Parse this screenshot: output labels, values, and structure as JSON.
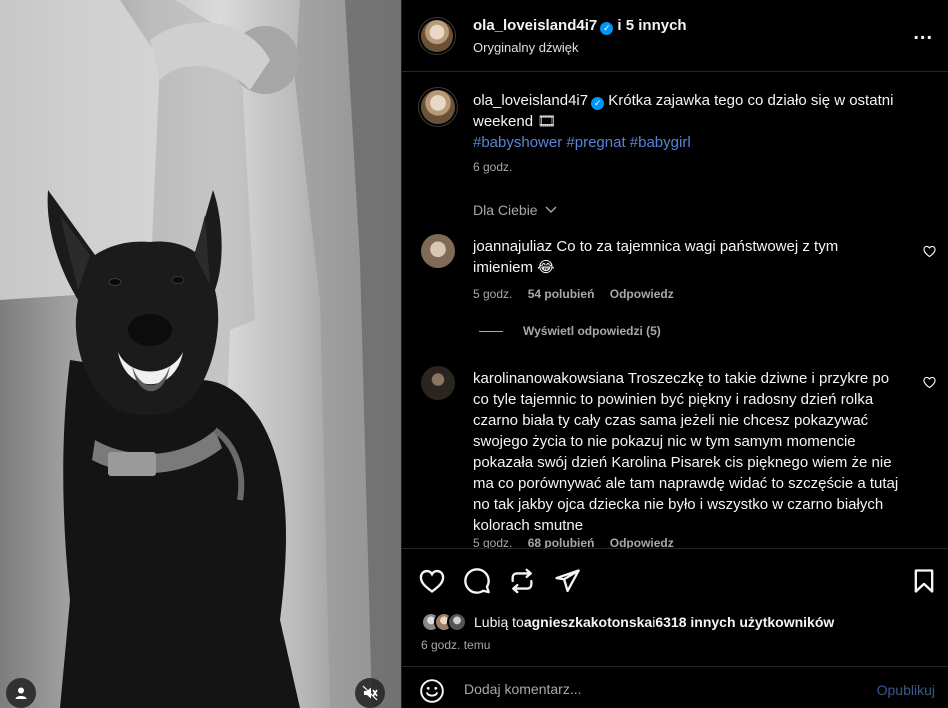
{
  "media": {
    "user_icon": "user-icon",
    "mute_icon": "speaker-muted-icon"
  },
  "header": {
    "username": "ola_loveisland4i7",
    "and_others": " i 5 innych",
    "subtitle": "Oryginalny dźwięk",
    "more": "..."
  },
  "caption": {
    "username": "ola_loveisland4i7",
    "text": " Krótka zajawka tego co działo się w ostatni weekend 🎞",
    "hashtags": "#babyshower #pregnat #babygirl",
    "time": "6 godz."
  },
  "comments_filter": {
    "label": "Dla Ciebie"
  },
  "comments": [
    {
      "username": "joannajuliaz",
      "text": " Co to za tajemnica wagi państwowej z tym imieniem 😂",
      "time": "5 godz.",
      "likes": "54 polubień",
      "reply": "Odpowiedz",
      "view_replies": "Wyświetl odpowiedzi (5)"
    },
    {
      "username": "karolinanowakowsiana",
      "text": " Troszeczkę to takie dziwne i przykre po co tyle tajemnic to powinien być piękny i radosny dzień rolka czarno biała ty cały czas sama jeżeli nie chcesz pokazywać swojego życia to nie pokazuj nic w tym samym momencie pokazała swój dzień Karolina Pisarek cis pięknego wiem że nie ma co porównywać ale tam naprawdę widać to szczęście a tutaj no tak jakby ojca dziecka nie było i wszystko w czarno białych kolorach smutne",
      "time": "5 godz.",
      "likes": "68 polubień",
      "reply": "Odpowiedz"
    }
  ],
  "likes": {
    "prefix": "Lubią to ",
    "user": "agnieszkakotonska",
    "middle": " i ",
    "others": "6318 innych użytkowników",
    "time": "6 godz. temu"
  },
  "comment_box": {
    "placeholder": "Dodaj komentarz...",
    "publish": "Opublikuj"
  },
  "colors": {
    "background": "#000000",
    "text": "#f5f5f5",
    "muted": "#a8a8a8",
    "hashtag": "#5b82d6",
    "verified": "#0095f6",
    "divider": "#262626"
  }
}
